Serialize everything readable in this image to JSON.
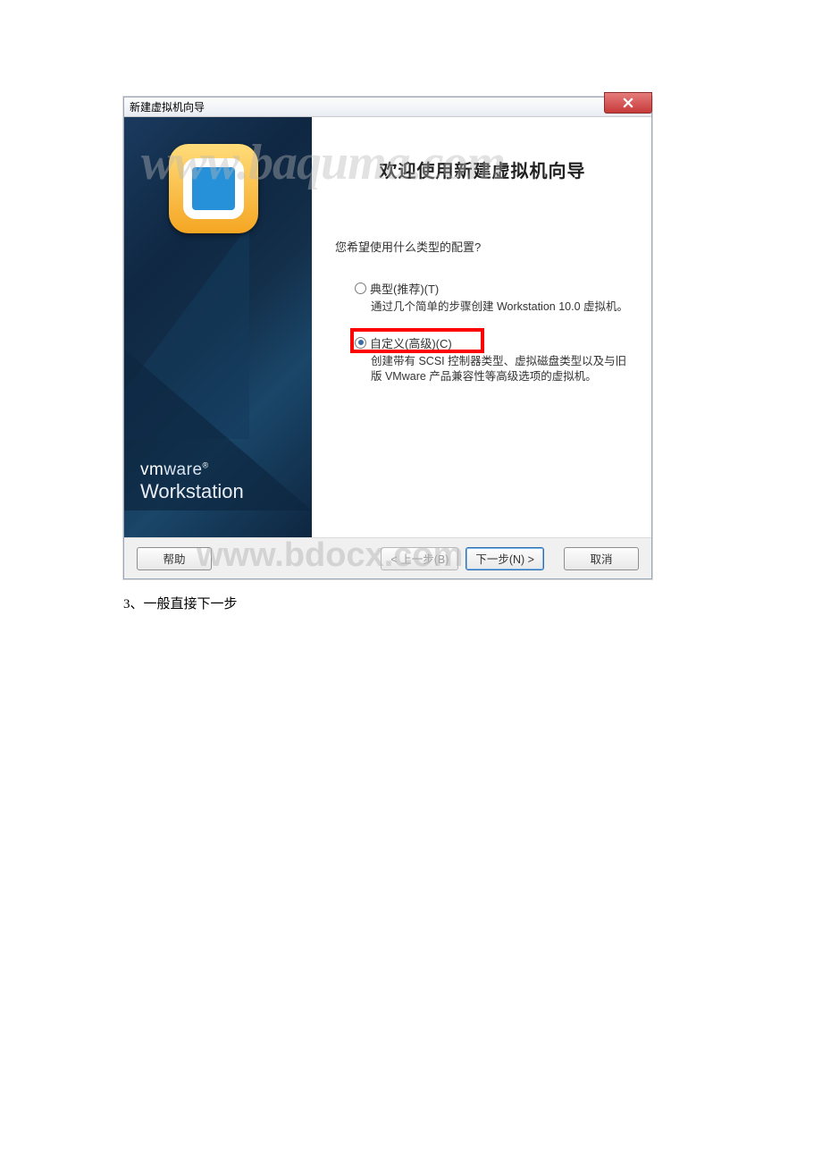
{
  "dialog": {
    "title": "新建虚拟机向导",
    "heading": "欢迎使用新建虚拟机向导",
    "question": "您希望使用什么类型的配置?",
    "option_typical": {
      "label": "典型(推荐)(T)",
      "desc": "通过几个简单的步骤创建 Workstation 10.0 虚拟机。"
    },
    "option_custom": {
      "label": "自定义(高级)(C)",
      "desc": "创建带有 SCSI 控制器类型、虚拟磁盘类型以及与旧版 VMware 产品兼容性等高级选项的虚拟机。"
    },
    "brand_line1_bold": "vm",
    "brand_line1_thin": "ware",
    "brand_reg": "®",
    "brand_line2": "Workstation",
    "buttons": {
      "help": "帮助",
      "back": "< 上一步(B)",
      "next": "下一步(N) >",
      "cancel": "取消"
    }
  },
  "watermarks": {
    "wm1": "www.baquma.com",
    "wm2": "www.bdocx.com"
  },
  "caption": "3、一般直接下一步"
}
